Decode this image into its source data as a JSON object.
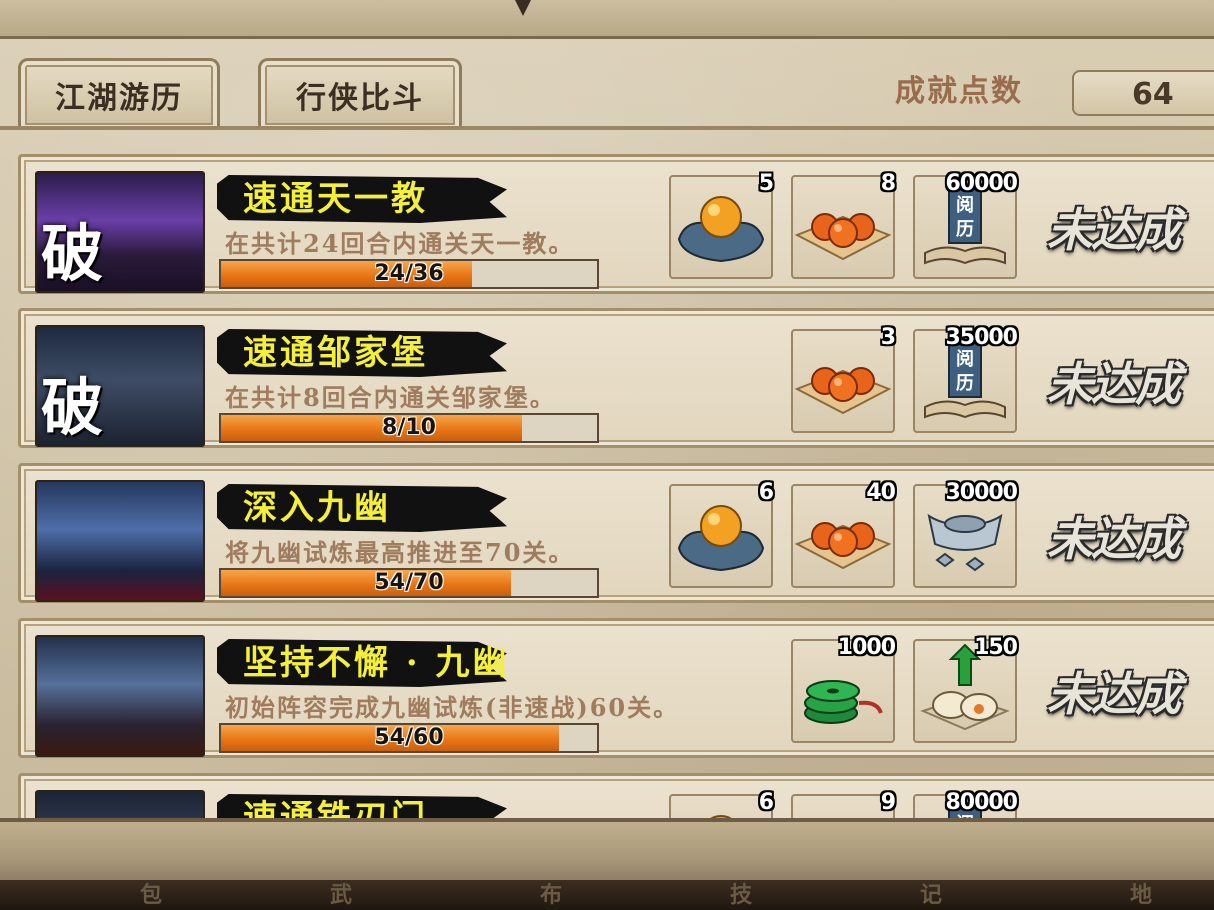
{
  "tabs": [
    {
      "label": "江湖游历"
    },
    {
      "label": "行侠比斗"
    }
  ],
  "score": {
    "label": "成就点数",
    "value": "64"
  },
  "achievements": [
    {
      "image": "tianyijiao-stage-art",
      "break_label": "破",
      "title": "速通天一教",
      "description": "在共计24回合内通关天一教。",
      "progress_text": "24/36",
      "progress": 0.667,
      "rewards": [
        {
          "icon": "gold-orb-icon",
          "qty": "5",
          "slot": 0
        },
        {
          "icon": "orange-orbs-icon",
          "qty": "8",
          "slot": 1
        },
        {
          "icon": "experience-book-icon",
          "qty": "60000",
          "slot": 2,
          "label": "阅历"
        }
      ],
      "status": "未达成"
    },
    {
      "image": "zoujiabao-stage-art",
      "break_label": "破",
      "title": "速通邹家堡",
      "description": "在共计8回合内通关邹家堡。",
      "progress_text": "8/10",
      "progress": 0.8,
      "rewards": [
        {
          "icon": "orange-orbs-icon",
          "qty": "3",
          "slot": 1
        },
        {
          "icon": "experience-book-icon",
          "qty": "35000",
          "slot": 2,
          "label": "阅历"
        }
      ],
      "status": "未达成"
    },
    {
      "image": "jiuyou-swordsman-art",
      "break_label": "",
      "title": "深入九幽",
      "description": "将九幽试炼最高推进至70关。",
      "progress_text": "54/70",
      "progress": 0.771,
      "rewards": [
        {
          "icon": "gold-orb-icon",
          "qty": "6",
          "slot": 0
        },
        {
          "icon": "orange-orbs-icon",
          "qty": "40",
          "slot": 1
        },
        {
          "icon": "silver-ingot-icon",
          "qty": "30000",
          "slot": 2
        }
      ],
      "status": "未达成"
    },
    {
      "image": "jiuyou-party-art",
      "break_label": "",
      "title": "坚持不懈 · 九幽",
      "description": "初始阵容完成九幽试炼(非速战)60关。",
      "progress_text": "54/60",
      "progress": 0.9,
      "rewards": [
        {
          "icon": "jade-coins-icon",
          "qty": "1000",
          "slot": 1
        },
        {
          "icon": "stamina-buns-icon",
          "qty": "150",
          "slot": 2
        }
      ],
      "status": "未达成"
    },
    {
      "image": "tierenmen-stage-art",
      "break_label": "",
      "title": "速通铁刃门",
      "description": "",
      "progress_text": "",
      "progress": 0,
      "rewards": [
        {
          "icon": "gold-orb-icon",
          "qty": "6",
          "slot": 0
        },
        {
          "icon": "orange-orbs-icon",
          "qty": "9",
          "slot": 1
        },
        {
          "icon": "experience-book-icon",
          "qty": "80000",
          "slot": 2,
          "label": "阅历"
        }
      ],
      "status": "未达成"
    }
  ],
  "bottom_menu": [
    {
      "label": "包"
    },
    {
      "label": "武"
    },
    {
      "label": "布"
    },
    {
      "label": "技"
    },
    {
      "label": "记"
    },
    {
      "label": "地"
    }
  ]
}
